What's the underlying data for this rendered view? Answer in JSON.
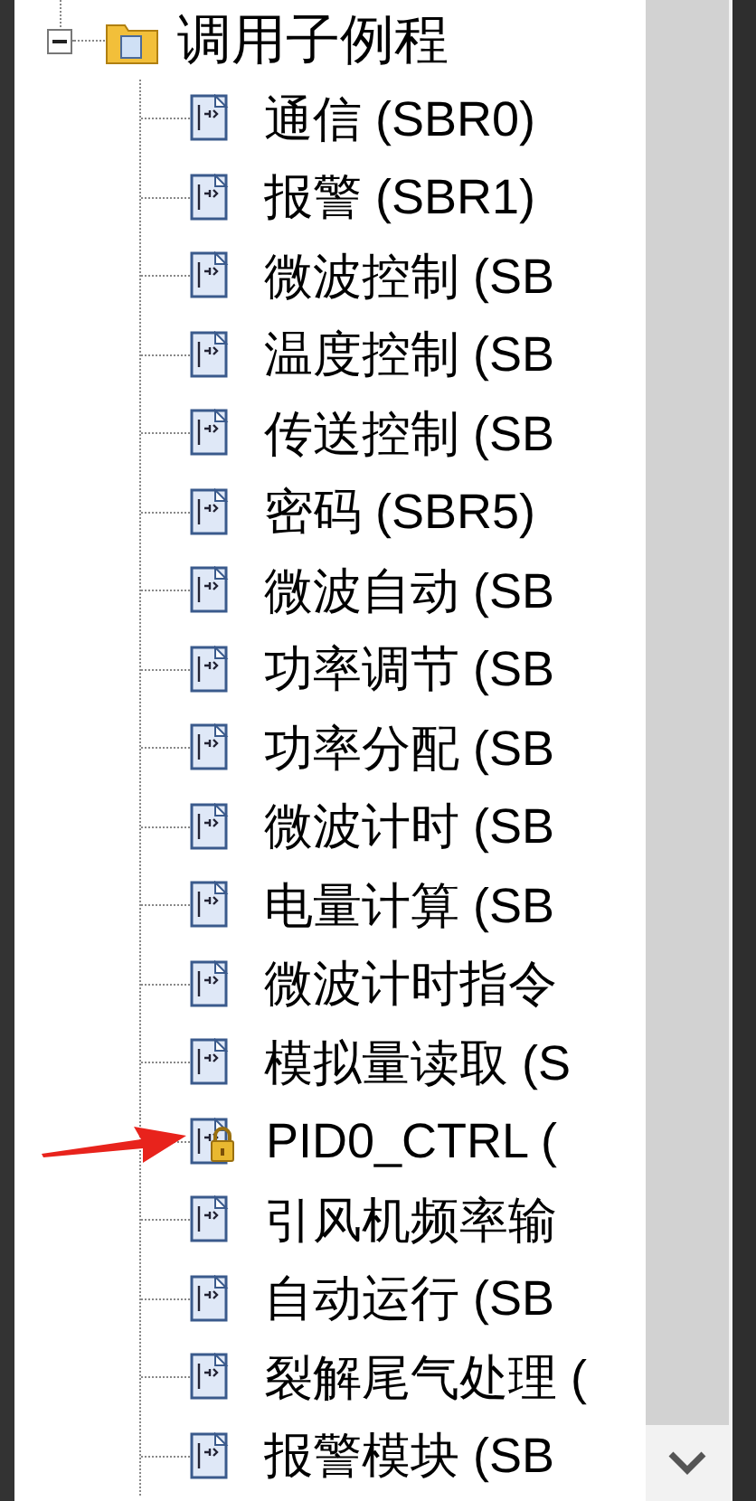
{
  "tree": {
    "root": {
      "label": "调用子例程",
      "expanded": true,
      "children": [
        {
          "label": "通信 (SBR0)",
          "kind": "program",
          "marked": false
        },
        {
          "label": "报警 (SBR1)",
          "kind": "program",
          "marked": false
        },
        {
          "label": "微波控制 (SB",
          "kind": "program",
          "marked": false
        },
        {
          "label": "温度控制 (SB",
          "kind": "program",
          "marked": false
        },
        {
          "label": "传送控制 (SB",
          "kind": "program",
          "marked": false
        },
        {
          "label": "密码 (SBR5)",
          "kind": "program",
          "marked": false
        },
        {
          "label": "微波自动 (SB",
          "kind": "program",
          "marked": false
        },
        {
          "label": "功率调节 (SB",
          "kind": "program",
          "marked": false
        },
        {
          "label": "功率分配 (SB",
          "kind": "program",
          "marked": false
        },
        {
          "label": "微波计时 (SB",
          "kind": "program",
          "marked": false
        },
        {
          "label": "电量计算 (SB",
          "kind": "program",
          "marked": false
        },
        {
          "label": "微波计时指令",
          "kind": "program",
          "marked": false
        },
        {
          "label": "模拟量读取 (S",
          "kind": "program",
          "marked": false
        },
        {
          "label": "PID0_CTRL (",
          "kind": "locked",
          "marked": true
        },
        {
          "label": "引风机频率输",
          "kind": "program",
          "marked": false
        },
        {
          "label": "自动运行 (SB",
          "kind": "program",
          "marked": false
        },
        {
          "label": "裂解尾气处理 (",
          "kind": "program",
          "marked": false
        },
        {
          "label": "报警模块 (SB",
          "kind": "program",
          "marked": false
        }
      ]
    }
  }
}
